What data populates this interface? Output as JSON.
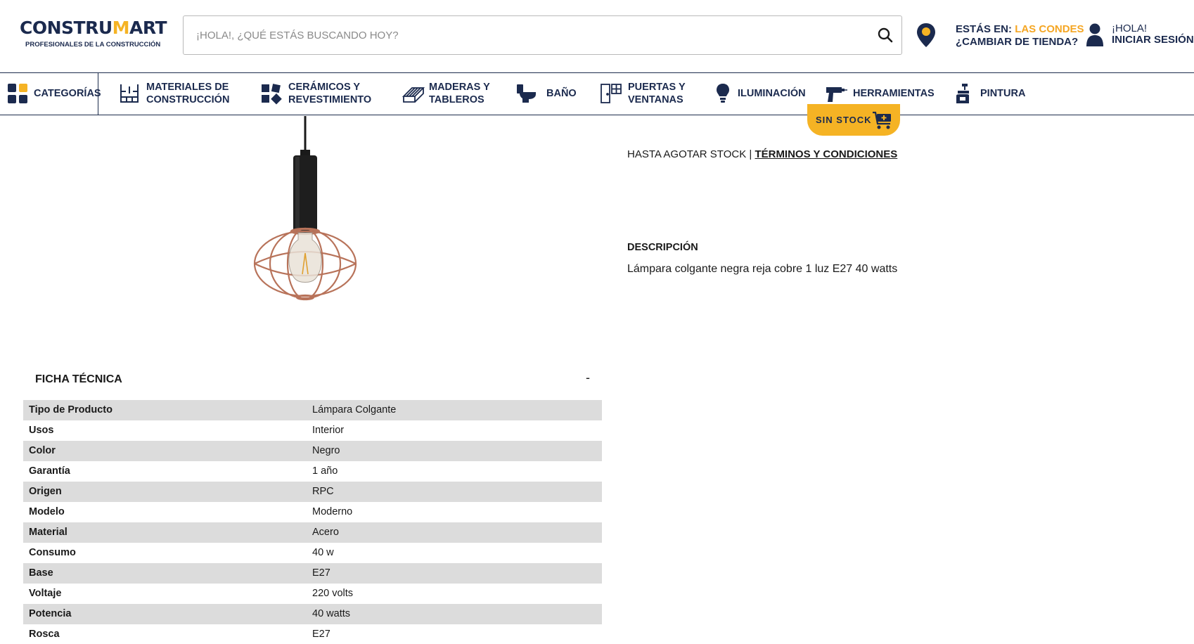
{
  "brand": {
    "logo_main": "CONSTRU",
    "logo_accent": "M",
    "logo_end": "ART",
    "tagline": "PROFESIONALES DE LA CONSTRUCCIÓN",
    "primary_color": "#1b2a4e",
    "accent_color": "#f5b324"
  },
  "search": {
    "placeholder": "¡HOLA!, ¿QUÉ ESTÁS BUSCANDO HOY?",
    "value": "",
    "icon": "search-icon"
  },
  "store": {
    "prefix": "ESTÁS EN: ",
    "name": "LAS CONDES",
    "change_label": "¿CAMBIAR DE TIENDA?",
    "icon": "location-pin-icon"
  },
  "account": {
    "greeting": "¡HOLA!",
    "login_label": "INICIAR SESIÓN",
    "icon": "user-icon"
  },
  "nav": {
    "categories": {
      "label": "CATEGORÍAS",
      "icon": "grid-icon"
    },
    "items": [
      {
        "line1": "MATERIALES DE",
        "line2": "CONSTRUCCIÓN",
        "icon": "bricks-icon"
      },
      {
        "line1": "CERÁMICOS Y",
        "line2": "REVESTIMIENTO",
        "icon": "tiles-icon"
      },
      {
        "line1": "MADERAS Y",
        "line2": "TABLEROS",
        "icon": "wood-icon"
      },
      {
        "line1": "BAÑO",
        "line2": "",
        "icon": "toilet-icon"
      },
      {
        "line1": "PUERTAS Y",
        "line2": "VENTANAS",
        "icon": "door-window-icon"
      },
      {
        "line1": "ILUMINACIÓN",
        "line2": "",
        "icon": "lightbulb-icon"
      },
      {
        "line1": "HERRAMIENTAS",
        "line2": "",
        "icon": "drill-icon"
      },
      {
        "line1": "PINTURA",
        "line2": "",
        "icon": "paint-icon"
      }
    ]
  },
  "product": {
    "image_icon": "pendant-lamp-image",
    "stock_button": "SIN STOCK",
    "stock_icon": "cart-add-icon",
    "terms_prefix": "HASTA AGOTAR STOCK | ",
    "terms_link": "TÉRMINOS Y CONDICIONES",
    "description_title": "DESCRIPCIÓN",
    "description": "Lámpara colgante negra reja cobre 1 luz E27 40 watts"
  },
  "spec": {
    "title": "FICHA TÉCNICA",
    "toggle": "-",
    "rows": [
      {
        "key": "Tipo de Producto",
        "value": "Lámpara Colgante"
      },
      {
        "key": "Usos",
        "value": "Interior"
      },
      {
        "key": "Color",
        "value": "Negro"
      },
      {
        "key": "Garantía",
        "value": "1 año"
      },
      {
        "key": "Origen",
        "value": "RPC"
      },
      {
        "key": "Modelo",
        "value": "Moderno"
      },
      {
        "key": "Material",
        "value": "Acero"
      },
      {
        "key": "Consumo",
        "value": "40 w"
      },
      {
        "key": "Base",
        "value": "E27"
      },
      {
        "key": "Voltaje",
        "value": "220 volts"
      },
      {
        "key": "Potencia",
        "value": "40 watts"
      },
      {
        "key": "Rosca",
        "value": "E27"
      }
    ]
  }
}
